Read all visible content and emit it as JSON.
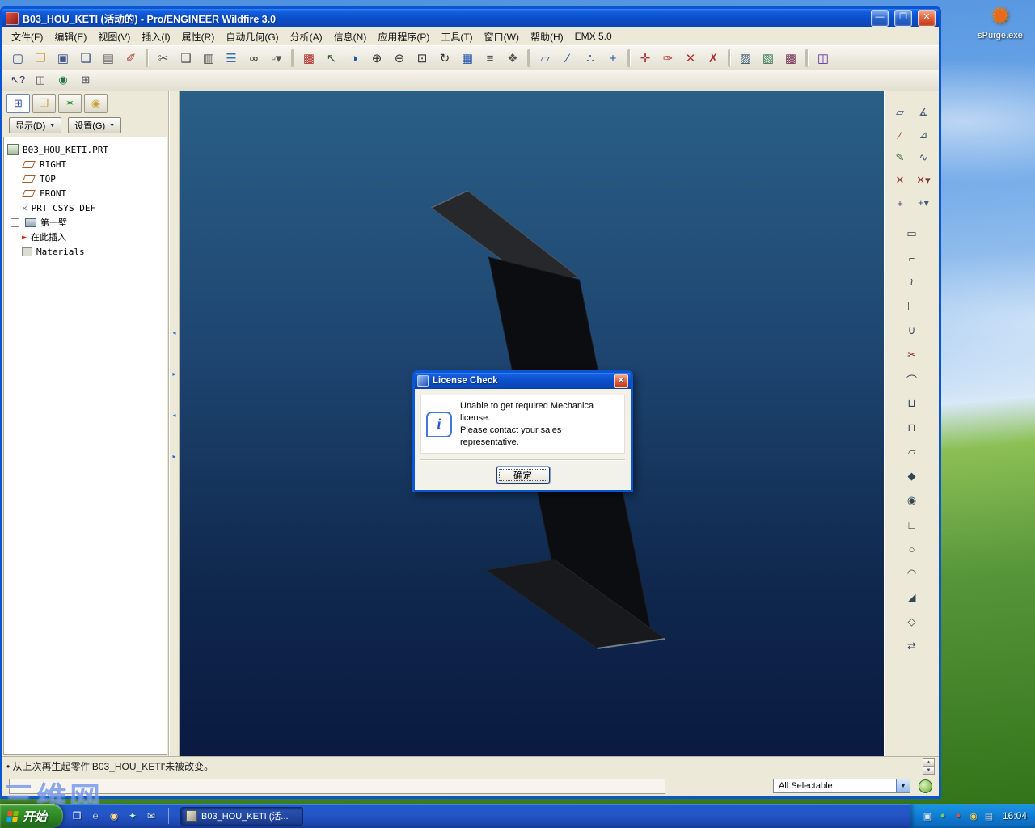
{
  "desktop": {
    "spurge_label": "sPurge.exe",
    "watermark": "三维网"
  },
  "glyphs": {
    "caret_down": "▼",
    "arrow_up": "▲",
    "arrow_down": "▼",
    "arrow_left": "◂",
    "arrow_right": "▸",
    "plus": "+",
    "insert_arrow": "►",
    "csys_cross": "✕",
    "spurge": "✹"
  },
  "window": {
    "title": "B03_HOU_KETI (活动的) - Pro/ENGINEER Wildfire 3.0",
    "controls": {
      "minimize": "—",
      "maximize": "❐",
      "close": "✕"
    },
    "menu": {
      "items": [
        "文件(F)",
        "编辑(E)",
        "视图(V)",
        "插入(I)",
        "属性(R)",
        "自动几何(G)",
        "分析(A)",
        "信息(N)",
        "应用程序(P)",
        "工具(T)",
        "窗口(W)",
        "帮助(H)",
        "EMX 5.0"
      ]
    },
    "toolbar_main": [
      {
        "name": "new-file-icon",
        "glyph": "▢",
        "color": "#44568a"
      },
      {
        "name": "open-file-icon",
        "glyph": "❐",
        "color": "#c89a30"
      },
      {
        "name": "save-icon",
        "glyph": "▣",
        "color": "#44568a"
      },
      {
        "name": "save-copy-icon",
        "glyph": "❏",
        "color": "#44568a"
      },
      {
        "name": "print-icon",
        "glyph": "▤",
        "color": "#666666"
      },
      {
        "name": "erase-icon",
        "glyph": "✐",
        "color": "#aa3333"
      },
      {
        "name": "separator"
      },
      {
        "name": "cut-icon",
        "glyph": "✂",
        "color": "#555555"
      },
      {
        "name": "copy-icon",
        "glyph": "❑",
        "color": "#555555"
      },
      {
        "name": "paste-icon",
        "glyph": "▥",
        "color": "#555555"
      },
      {
        "name": "select-list-icon",
        "glyph": "☰",
        "color": "#3b6fb0"
      },
      {
        "name": "find-icon",
        "glyph": "∞",
        "color": "#333333"
      },
      {
        "name": "select-box-icon",
        "glyph": "▫▾",
        "color": "#555555"
      },
      {
        "name": "separator"
      },
      {
        "name": "regenerate-icon",
        "glyph": "▩",
        "color": "#b03030"
      },
      {
        "name": "select-working-icon",
        "glyph": "↖",
        "color": "#335533"
      },
      {
        "name": "shade-icon",
        "glyph": "◑",
        "color": "#2255aa"
      },
      {
        "name": "zoom-in-icon",
        "glyph": "⊕",
        "color": "#333333"
      },
      {
        "name": "zoom-out-icon",
        "glyph": "⊖",
        "color": "#333333"
      },
      {
        "name": "refit-icon",
        "glyph": "⊡",
        "color": "#333333"
      },
      {
        "name": "reorient-icon",
        "glyph": "↻",
        "color": "#333333"
      },
      {
        "name": "redraw-icon",
        "glyph": "▦",
        "color": "#2255aa"
      },
      {
        "name": "layers-icon",
        "glyph": "≡",
        "color": "#555555"
      },
      {
        "name": "view-manager-icon",
        "glyph": "❖",
        "color": "#555555"
      },
      {
        "name": "separator"
      },
      {
        "name": "datum-planes-toggle-icon",
        "glyph": "▱",
        "color": "#2255aa"
      },
      {
        "name": "datum-axes-toggle-icon",
        "glyph": "∕",
        "color": "#2255aa"
      },
      {
        "name": "datum-points-toggle-icon",
        "glyph": "∴",
        "color": "#2255aa"
      },
      {
        "name": "csys-toggle-icon",
        "glyph": "+",
        "color": "#2255aa"
      },
      {
        "name": "separator"
      },
      {
        "name": "spin-center-toggle-icon",
        "glyph": "✛",
        "color": "#aa3333"
      },
      {
        "name": "annotation-toggle-icon",
        "glyph": "✑",
        "color": "#aa3333"
      },
      {
        "name": "point-tag-toggle-icon",
        "glyph": "✕",
        "color": "#aa3333"
      },
      {
        "name": "csys-tag-toggle-icon",
        "glyph": "✗",
        "color": "#aa3333"
      },
      {
        "name": "separator"
      },
      {
        "name": "appearance-icon",
        "glyph": "▨",
        "color": "#335577"
      },
      {
        "name": "render-icon",
        "glyph": "▧",
        "color": "#337755"
      },
      {
        "name": "color-effects-icon",
        "glyph": "▩",
        "color": "#773355"
      },
      {
        "name": "separator"
      },
      {
        "name": "emx-window-icon",
        "glyph": "◫",
        "color": "#663399"
      }
    ],
    "toolbar_secondary": [
      {
        "name": "context-help-icon",
        "glyph": "↖?",
        "color": "#333355"
      },
      {
        "name": "sash-window-icon",
        "glyph": "◫",
        "color": "#555566"
      },
      {
        "name": "web-browser-icon",
        "glyph": "◉",
        "color": "#227744"
      },
      {
        "name": "model-grid-icon",
        "glyph": "⊞",
        "color": "#555566"
      }
    ],
    "navigator": {
      "tabs": [
        {
          "name": "model-tree-tab",
          "glyph": "⊞",
          "color": "#3355aa"
        },
        {
          "name": "folder-browser-tab",
          "glyph": "❐",
          "color": "#caa23a"
        },
        {
          "name": "favorites-tab",
          "glyph": "✶",
          "color": "#2a8a2a"
        },
        {
          "name": "connections-tab",
          "glyph": "◉",
          "color": "#caa23a"
        }
      ],
      "show_button": "显示(D)",
      "settings_button": "设置(G)",
      "tree": {
        "items": [
          {
            "label": "B03_HOU_KETI.PRT",
            "icon": "part"
          },
          {
            "label": "RIGHT",
            "icon": "datum-plane"
          },
          {
            "label": "TOP",
            "icon": "datum-plane"
          },
          {
            "label": "FRONT",
            "icon": "datum-plane"
          },
          {
            "label": "PRT_CSYS_DEF",
            "icon": "csys"
          },
          {
            "label": "第一壁",
            "icon": "wall",
            "expandable": true
          },
          {
            "label": "在此插入",
            "icon": "insert-here"
          },
          {
            "label": "Materials",
            "icon": "materials"
          }
        ]
      }
    },
    "right_toolbar_top": [
      {
        "name": "datum-plane-tool-icon",
        "glyph": "▱",
        "color": "#445577"
      },
      {
        "name": "measure-tool-icon",
        "glyph": "∡",
        "color": "#445577"
      },
      {
        "name": "datum-axis-tool-icon",
        "glyph": "∕",
        "color": "#884422"
      },
      {
        "name": "insert-mode-icon",
        "glyph": "⊿",
        "color": "#445577"
      },
      {
        "name": "sketch-tool-icon",
        "glyph": "✎",
        "color": "#336633"
      },
      {
        "name": "datum-curve-tool-icon",
        "glyph": "∿",
        "color": "#445577"
      },
      {
        "name": "datum-point-tool-icon",
        "glyph": "✕",
        "color": "#883333"
      },
      {
        "name": "point-options-icon",
        "glyph": "✕▾",
        "color": "#883333"
      },
      {
        "name": "datum-csys-tool-icon",
        "glyph": "+",
        "color": "#445577"
      },
      {
        "name": "csys-options-icon",
        "glyph": "+▾",
        "color": "#445577"
      }
    ],
    "right_toolbar_main": [
      {
        "name": "flat-wall-tool-icon",
        "glyph": "▭",
        "color": "#334455"
      },
      {
        "name": "flange-wall-tool-icon",
        "glyph": "⌐",
        "color": "#334455"
      },
      {
        "name": "twist-wall-tool-icon",
        "glyph": "≀",
        "color": "#334455"
      },
      {
        "name": "extend-wall-tool-icon",
        "glyph": "⊢",
        "color": "#334455"
      },
      {
        "name": "merge-wall-tool-icon",
        "glyph": "∪",
        "color": "#334455"
      },
      {
        "name": "rip-tool-icon",
        "glyph": "✂",
        "color": "#883333"
      },
      {
        "name": "bend-tool-icon",
        "glyph": "⌒",
        "color": "#334455"
      },
      {
        "name": "unbend-tool-icon",
        "glyph": "⊔",
        "color": "#334455"
      },
      {
        "name": "bend-back-tool-icon",
        "glyph": "⊓",
        "color": "#334455"
      },
      {
        "name": "flat-pattern-tool-icon",
        "glyph": "▱",
        "color": "#334455"
      },
      {
        "name": "form-tool-icon",
        "glyph": "◆",
        "color": "#334455"
      },
      {
        "name": "punch-tool-icon",
        "glyph": "◉",
        "color": "#334455"
      },
      {
        "name": "corner-relief-tool-icon",
        "glyph": "∟",
        "color": "#334455"
      },
      {
        "name": "hole-tool-icon",
        "glyph": "○",
        "color": "#334455"
      },
      {
        "name": "round-tool-icon",
        "glyph": "◠",
        "color": "#334455"
      },
      {
        "name": "chamfer-tool-icon",
        "glyph": "◢",
        "color": "#334455"
      },
      {
        "name": "shell-tool-icon",
        "glyph": "◇",
        "color": "#334455"
      },
      {
        "name": "mirror-tool-icon",
        "glyph": "⇄",
        "color": "#334455"
      }
    ],
    "dialog": {
      "title": "License Check",
      "info_glyph": "i",
      "message_line1": "Unable to get required Mechanica license.",
      "message_line2": "Please contact your sales representative.",
      "ok_label": "确定"
    },
    "status": {
      "bullet": "•",
      "message": "从上次再生起零件'B03_HOU_KETI'未被改变。"
    },
    "selector": {
      "value": "All Selectable"
    }
  },
  "taskbar": {
    "start_label": "开始",
    "quicklaunch": [
      {
        "name": "show-desktop-icon",
        "glyph": "❒",
        "color": "#e8f0ff"
      },
      {
        "name": "internet-explorer-icon",
        "glyph": "℮",
        "color": "#bcd8ff"
      },
      {
        "name": "media-player-icon",
        "glyph": "◉",
        "color": "#ffd890"
      },
      {
        "name": "messenger-icon",
        "glyph": "✦",
        "color": "#c8f0e0"
      },
      {
        "name": "outlook-icon",
        "glyph": "✉",
        "color": "#e8e8ff"
      }
    ],
    "task_button": "B03_HOU_KETI (活...",
    "tray_icons": [
      {
        "name": "ime-language-icon",
        "glyph": "▣",
        "color": "#d8e8ff"
      },
      {
        "name": "antivirus-tray-icon",
        "glyph": "●",
        "color": "#70d060"
      },
      {
        "name": "update-tray-icon",
        "glyph": "●",
        "color": "#e05040"
      },
      {
        "name": "volume-tray-icon",
        "glyph": "◉",
        "color": "#ffd050"
      },
      {
        "name": "network-tray-icon",
        "glyph": "▤",
        "color": "#c0d8f0"
      }
    ],
    "clock": "16:04"
  }
}
